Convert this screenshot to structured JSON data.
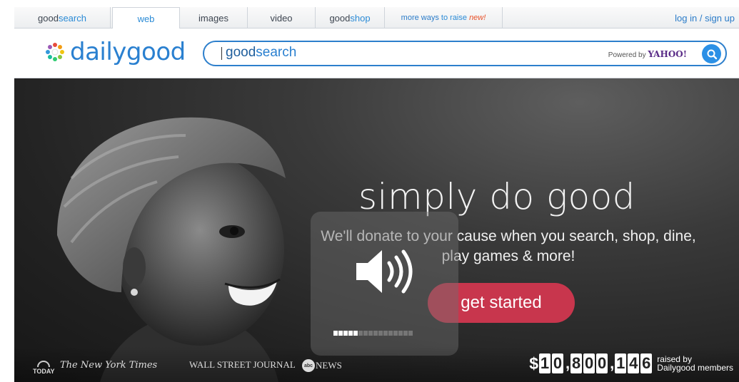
{
  "nav": {
    "tabs": [
      {
        "pre": "good",
        "hi": "search"
      },
      {
        "label": "web"
      },
      {
        "label": "images"
      },
      {
        "label": "video"
      },
      {
        "pre": "good",
        "hi": "shop"
      },
      {
        "pre": "more ways ",
        "hi": "to raise ",
        "badge": "new!"
      }
    ],
    "login": "log in / sign up"
  },
  "header": {
    "logo": "dailygood",
    "search_brand_good": "good",
    "search_brand_search": "search",
    "powered_by": "Powered by",
    "powered_brand": "YAHOO!"
  },
  "hero": {
    "headline": "simply do good",
    "subline": "We'll donate to your cause when you search, shop, dine, play games & more!",
    "cta": "get started"
  },
  "volume": {
    "level": 5,
    "max": 16
  },
  "press": {
    "today": "TODAY",
    "nyt": "The New York Times",
    "wsj": "WALL STREET JOURNAL",
    "abc_logo": "abc",
    "abc": "NEWS"
  },
  "counter": {
    "currency": "$",
    "groups": [
      "10",
      "800",
      "146"
    ],
    "raised_1": "raised by",
    "raised_2": "Dailygood members"
  }
}
